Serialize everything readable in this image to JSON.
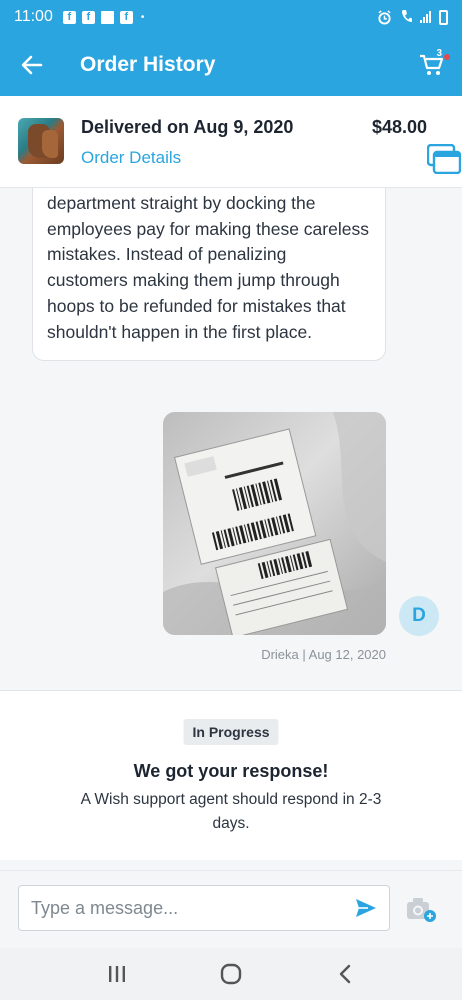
{
  "status_bar": {
    "time": "11:00",
    "notification_icons": [
      "facebook-icon",
      "facebook-icon",
      "message-icon",
      "facebook-icon"
    ],
    "dot": "•"
  },
  "app_bar": {
    "title": "Order History",
    "cart_count": "3",
    "accent_color": "#2aa5df",
    "cart_dot_color": "#e54a4a"
  },
  "order": {
    "status": "Delivered on Aug 9, 2020",
    "details_link": "Order Details",
    "price": "$48.00"
  },
  "chat": {
    "message_text": "do is get the idiots in your shipping department straight by docking the employees pay for making these careless mistakes. Instead of penalizing customers making them jump through hoops to be refunded for mistakes that shouldn't happen in the first place.",
    "avatar_initial": "D",
    "meta": "Drieka | Aug 12, 2020"
  },
  "status_panel": {
    "badge": "In Progress",
    "title": "We got your response!",
    "text": "A Wish support agent should respond in 2-3 days."
  },
  "composer": {
    "placeholder": "Type a message..."
  }
}
